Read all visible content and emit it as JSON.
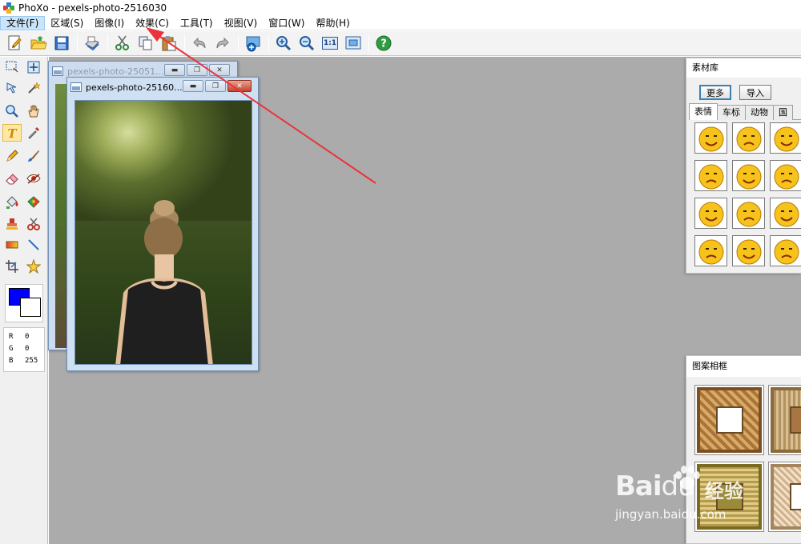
{
  "window": {
    "title": "PhoXo - pexels-photo-2516030"
  },
  "menu": [
    {
      "label": "文件(F)",
      "active": true
    },
    {
      "label": "区域(S)"
    },
    {
      "label": "图像(I)"
    },
    {
      "label": "效果(C)"
    },
    {
      "label": "工具(T)"
    },
    {
      "label": "视图(V)"
    },
    {
      "label": "窗口(W)"
    },
    {
      "label": "帮助(H)"
    }
  ],
  "toolbar": {
    "buttons": [
      "new-icon",
      "open-folder-icon",
      "save-icon",
      "scan-icon",
      "cut-icon",
      "copy-icon",
      "paste-icon",
      "undo-icon",
      "redo-icon",
      "screen-capture-icon",
      "zoom-in-icon",
      "zoom-out-icon",
      "actual-size-icon",
      "fit-window-icon",
      "help-icon"
    ],
    "actual_size_label": "1:1"
  },
  "colors": {
    "foreground": "#0000ff",
    "background": "#ffffff",
    "workspace": "#ababab"
  },
  "rgb": {
    "r_label": "R",
    "r_value": "0",
    "g_label": "G",
    "g_value": "0",
    "b_label": "B",
    "b_value": "255"
  },
  "documents": [
    {
      "title": "pexels-photo-25051..."
    },
    {
      "title": "pexels-photo-25160..."
    }
  ],
  "asset_library": {
    "title": "素材库",
    "more_label": "更多",
    "import_label": "导入",
    "tabs": [
      "表情",
      "车标",
      "动物",
      "国"
    ],
    "active_tab": "表情"
  },
  "frames_panel": {
    "title": "图案相框"
  },
  "watermark": {
    "logo": "Bai",
    "logo_suffix": "du",
    "cn": "经验",
    "url": "jingyan.baidu.com"
  }
}
